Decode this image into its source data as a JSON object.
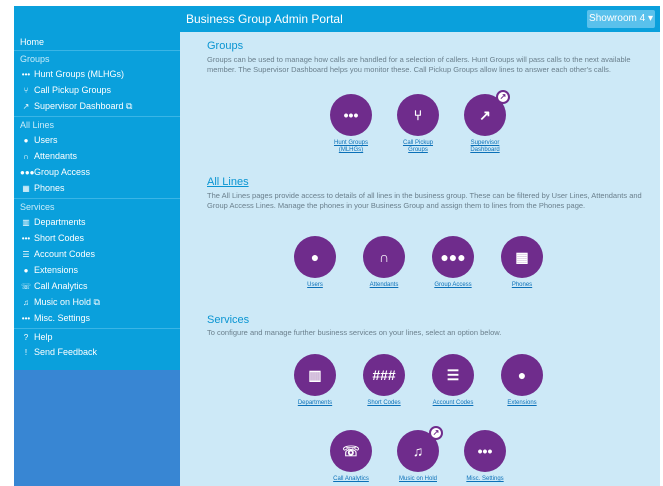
{
  "header": {
    "title": "Business Group Admin Portal",
    "showroom_label": "Showroom 4 ▾"
  },
  "sidebar": {
    "home": "Home",
    "groups_section": "Groups",
    "hunt_groups": "Hunt Groups (MLHGs)",
    "call_pickup": "Call Pickup Groups",
    "supervisor": "Supervisor Dashboard ⧉",
    "all_lines_section": "All Lines",
    "users": "Users",
    "attendants": "Attendants",
    "group_access": "Group Access",
    "phones": "Phones",
    "services_section": "Services",
    "departments": "Departments",
    "short_codes": "Short Codes",
    "account_codes": "Account Codes",
    "extensions": "Extensions",
    "call_analytics": "Call Analytics",
    "music_on_hold": "Music on Hold ⧉",
    "misc_settings": "Misc. Settings",
    "help": "Help",
    "send_feedback": "Send Feedback"
  },
  "groups": {
    "title": "Groups",
    "description": "Groups can be used to manage how calls are handled for a selection of callers. Hunt Groups will pass calls to the next available member. The Supervisor Dashboard helps you monitor these. Call Pickup Groups allow lines to answer each other's calls.",
    "tiles": [
      {
        "label": "Hunt Groups (MLHGs)"
      },
      {
        "label": "Call Pickup Groups"
      },
      {
        "label": "Supervisor Dashboard"
      }
    ]
  },
  "all_lines": {
    "title": "All Lines",
    "description": "The All Lines pages provide access to details of all lines in the business group. These can be filtered by User Lines, Attendants and Group Access Lines. Manage the phones in your Business Group and assign them to lines from the Phones page.",
    "tiles": [
      {
        "label": "Users"
      },
      {
        "label": "Attendants"
      },
      {
        "label": "Group Access"
      },
      {
        "label": "Phones"
      }
    ]
  },
  "services": {
    "title": "Services",
    "description": "To configure and manage further business services on your lines, select an option below.",
    "tiles": [
      {
        "label": "Departments"
      },
      {
        "label": "Short Codes"
      },
      {
        "label": "Account Codes"
      },
      {
        "label": "Extensions"
      },
      {
        "label": "Call Analytics"
      },
      {
        "label": "Music on Hold"
      },
      {
        "label": "Misc. Settings"
      }
    ]
  },
  "icons": {
    "hunt": "•••",
    "pickup": "⑂",
    "supervisor": "↗",
    "users": "●",
    "attendants": "∩",
    "group_access": "●●●",
    "phones": "▦",
    "departments": "▥",
    "short_codes": "###",
    "account_codes": "☰",
    "extensions": "●",
    "call_analytics": "☏",
    "music": "♫",
    "misc": "•••",
    "ext_badge": "↗"
  },
  "colors": {
    "header": "#0aa0dc",
    "sidebar": "#0aa0dc",
    "sidebar_bottom": "#3886d3",
    "content_bg": "#cde9f7",
    "tile": "#6f2c8c",
    "heading": "#0a95d2"
  }
}
